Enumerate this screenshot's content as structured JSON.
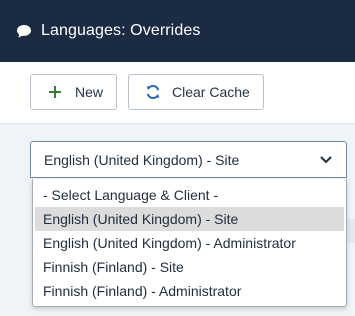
{
  "header": {
    "title": "Languages: Overrides",
    "icon": "comment-icon"
  },
  "toolbar": {
    "new_label": "New",
    "new_icon": "plus-icon",
    "clear_cache_label": "Clear Cache",
    "clear_cache_icon": "refresh-icon"
  },
  "language_select": {
    "selected_value": "English (United Kingdom) - Site",
    "expanded": true,
    "options": [
      {
        "label": "- Select Language & Client -",
        "selected": false
      },
      {
        "label": "English (United Kingdom) - Site",
        "selected": true
      },
      {
        "label": "English (United Kingdom) - Administrator",
        "selected": false
      },
      {
        "label": "Finnish (Finland) - Site",
        "selected": false
      },
      {
        "label": "Finnish (Finland) - Administrator",
        "selected": false
      }
    ]
  },
  "colors": {
    "header_bg": "#1b2b42",
    "page_bg": "#f0f4f8",
    "accent_green": "#2f7d32",
    "accent_blue": "#2a69b8",
    "selected_option_bg": "#dcdcdc"
  }
}
